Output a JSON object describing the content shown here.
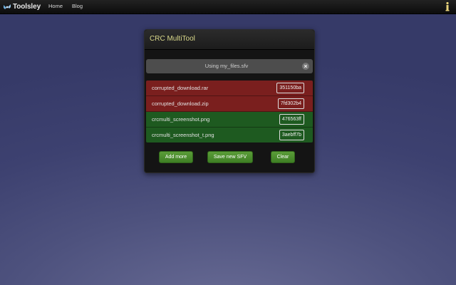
{
  "topbar": {
    "brand_label": "Toolsley",
    "nav": [
      {
        "label": "Home"
      },
      {
        "label": "Blog"
      }
    ]
  },
  "panel": {
    "title": "CRC MultiTool",
    "sfv_label": "Using my_files.sfv",
    "files": [
      {
        "name": "corrupted_download.rar",
        "crc": "351150ba",
        "status": "bad"
      },
      {
        "name": "corrupted_download.zip",
        "crc": "7fd302b4",
        "status": "bad"
      },
      {
        "name": "crcmulti_screenshot.png",
        "crc": "476563ff",
        "status": "good"
      },
      {
        "name": "crcmulti_screenshot_t.png",
        "crc": "3aebff7b",
        "status": "good"
      }
    ],
    "buttons": {
      "add_more": "Add more",
      "save_new_sfv": "Save new SFV",
      "clear": "Clear"
    }
  },
  "colors": {
    "bad_row": "#7a1f1e",
    "good_row": "#1e5a20",
    "button": "#4a8c2c",
    "title": "#d9d88a"
  },
  "icons": [
    "toolsley-logo-icon",
    "info-icon",
    "close-icon"
  ]
}
